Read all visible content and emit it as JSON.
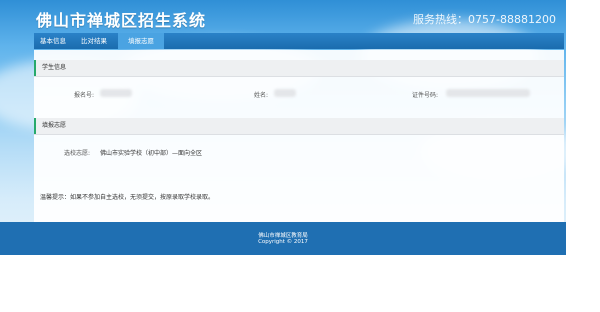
{
  "header": {
    "site_title": "佛山市禅城区招生系统",
    "hotline": "服务热线：0757-88881200"
  },
  "nav": {
    "items": [
      {
        "label": "基本信息"
      },
      {
        "label": "比对结果"
      },
      {
        "label": "填报志愿"
      }
    ],
    "active_index": 2
  },
  "student_info": {
    "title": "学生信息",
    "fields": [
      {
        "label": "报名号:"
      },
      {
        "label": "姓名:"
      },
      {
        "label": "证件号码:"
      }
    ]
  },
  "choice": {
    "title": "填报志愿",
    "label": "选校志愿:",
    "value": "佛山市实验学校（初中部）—面向全区"
  },
  "tip": "温馨提示：如果不参加自主选校，无须提交，按原录取学校录取。",
  "footer": {
    "line1": "佛山市禅城区教育局",
    "line2": "Copyright © 2017"
  },
  "colors": {
    "nav_bg": "#1b6cae",
    "nav_active": "#4aa3e2",
    "section_accent": "#27a96b",
    "footer_bg": "#1f6fb2"
  }
}
